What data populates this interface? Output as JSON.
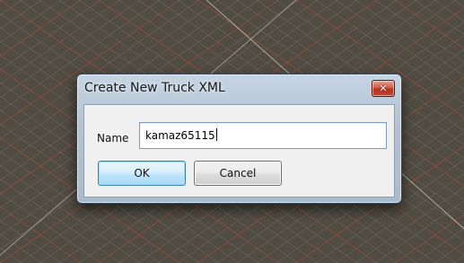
{
  "dialog": {
    "title": "Create New Truck XML",
    "close_symbol": "✕",
    "name_label": "Name",
    "name_value": "kamaz65115",
    "ok_label": "OK",
    "cancel_label": "Cancel"
  },
  "scene": {
    "floor_color": "#514c42",
    "grid_line_color": "#7d7a72",
    "axis_color": "#b04a3e"
  },
  "icons": {
    "close": "close-icon"
  }
}
